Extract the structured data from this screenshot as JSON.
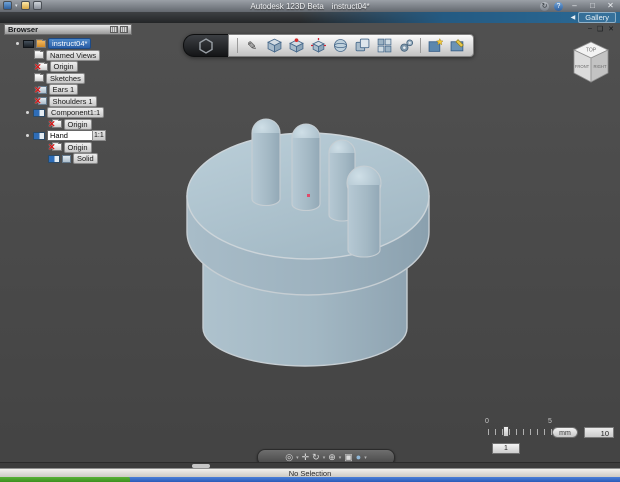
{
  "window": {
    "app_title": "Autodesk 123D Beta",
    "doc_title": "instruct04*",
    "minimize": "–",
    "maximize": "□",
    "close": "✕",
    "help": "?",
    "gallery": {
      "back_arrow": "◀",
      "label": "Gallery"
    },
    "doc_controls": {
      "minimize": "–",
      "restore": "❑",
      "close": "✕"
    }
  },
  "browser": {
    "title": "Browser",
    "rename_input": {
      "value": "Hand"
    },
    "tree": [
      {
        "label": "instruct04*"
      },
      {
        "label": "Named Views"
      },
      {
        "label": "Origin"
      },
      {
        "label": "Sketches"
      },
      {
        "label": "Ears 1"
      },
      {
        "label": "Shoulders 1"
      },
      {
        "label": "Component1:1"
      },
      {
        "label": "Origin"
      },
      {
        "label": "Hand",
        "suffix": "1:1"
      },
      {
        "label": "Origin"
      },
      {
        "label": "Solid"
      }
    ]
  },
  "toolbar": {
    "icons": [
      "hexagon-menu",
      "pen-tool",
      "cube-primitive",
      "cube-vertex-edit",
      "cube-move",
      "sphere-primitive",
      "combine",
      "pattern-grid",
      "gears",
      "star-document",
      "image-edit"
    ]
  },
  "viewcube": {
    "top": "TOP",
    "front": "FRONT",
    "right": "RIGHT"
  },
  "navbar": {
    "dropdown_glyph": "▾",
    "icons": [
      {
        "name": "steering-wheel",
        "glyph": "◎"
      },
      {
        "name": "pan",
        "glyph": "✛"
      },
      {
        "name": "orbit",
        "glyph": "↻"
      },
      {
        "name": "zoom",
        "glyph": "⊕"
      },
      {
        "name": "look-at",
        "glyph": "▣"
      },
      {
        "name": "visual-style",
        "glyph": "●"
      }
    ]
  },
  "controls": {
    "snap": {
      "min_label": "0",
      "max_label": "5",
      "value": "1"
    },
    "units": "mm",
    "grid_size": "10"
  },
  "statusbar": {
    "text": "No Selection"
  },
  "colors": {
    "viewport_bg": "#4a4a4a",
    "model_fill": "#a5bac6",
    "model_top": "#b4c8d3",
    "selection_blue": "#2f6db8",
    "origin_dot": "#e04a6a",
    "menustrip_blue": "#2b6a96",
    "taskbar_blue": "#3a76d6",
    "start_green": "#47a02a"
  }
}
